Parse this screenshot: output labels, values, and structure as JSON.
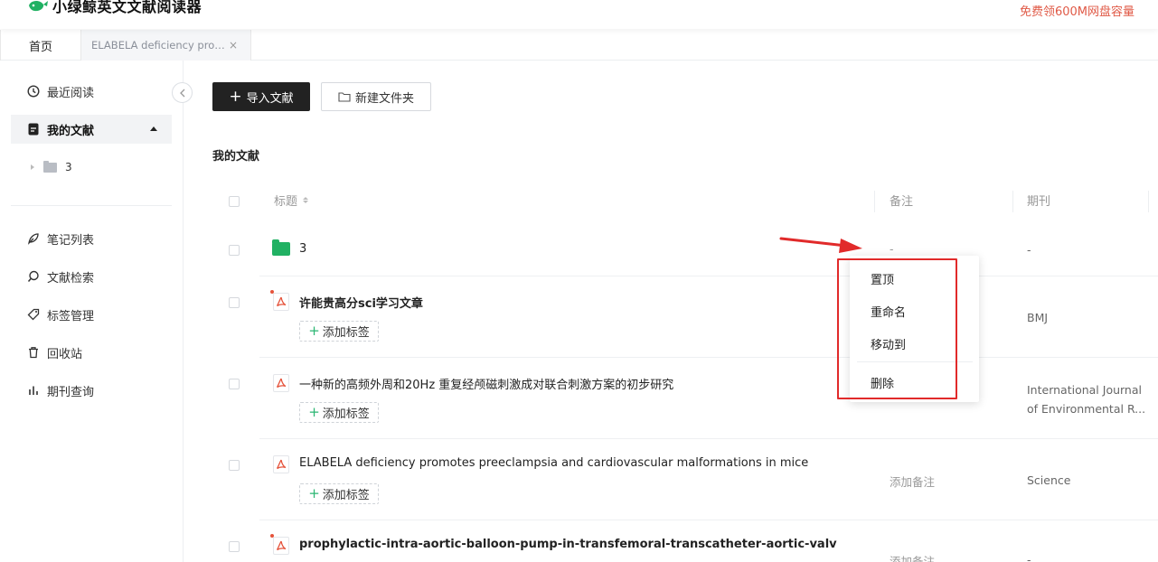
{
  "app": {
    "name": "小绿鲸英文文献阅读器",
    "promo": "免费领600M网盘容量",
    "brand_color": "#21b163",
    "accent_red": "#e12a2a"
  },
  "tabs": [
    {
      "label": "首页"
    },
    {
      "label": "ELABELA deficiency promotes preeclampsia and cardiovascular malformations in mice",
      "close": "×"
    }
  ],
  "sidebar": {
    "recent": "最近阅读",
    "my_docs": "我的文献",
    "folder_name": "3",
    "notes": "笔记列表",
    "search": "文献检索",
    "tags": "标签管理",
    "trash": "回收站",
    "journal": "期刊查询"
  },
  "toolbar": {
    "import_label": "导入文献",
    "new_folder_label": "新建文件夹"
  },
  "main": {
    "section_title": "我的文献",
    "columns": {
      "title": "标题",
      "note": "备注",
      "journal": "期刊"
    },
    "add_tag": "添加标签",
    "rows": [
      {
        "title": "3",
        "note": "-",
        "journal": "-"
      },
      {
        "title": "许能贵高分sci学习文章",
        "note": "",
        "journal": "BMJ"
      },
      {
        "title": "一种新的高频外周和20Hz 重复经颅磁刺激成对联合刺激方案的初步研究",
        "note": "",
        "journal_line1": "International Journal",
        "journal_line2": "of Environmental R..."
      },
      {
        "title": "ELABELA deficiency promotes preeclampsia and cardiovascular malformations in mice",
        "note": "添加备注",
        "journal": "Science"
      },
      {
        "title": "prophylactic-intra-aortic-balloon-pump-in-transfemoral-transcatheter-aortic-valv",
        "note": "添加备注",
        "journal": "-"
      }
    ]
  },
  "context_menu": {
    "pin": "置顶",
    "rename": "重命名",
    "move_to": "移动到",
    "delete": "删除"
  }
}
